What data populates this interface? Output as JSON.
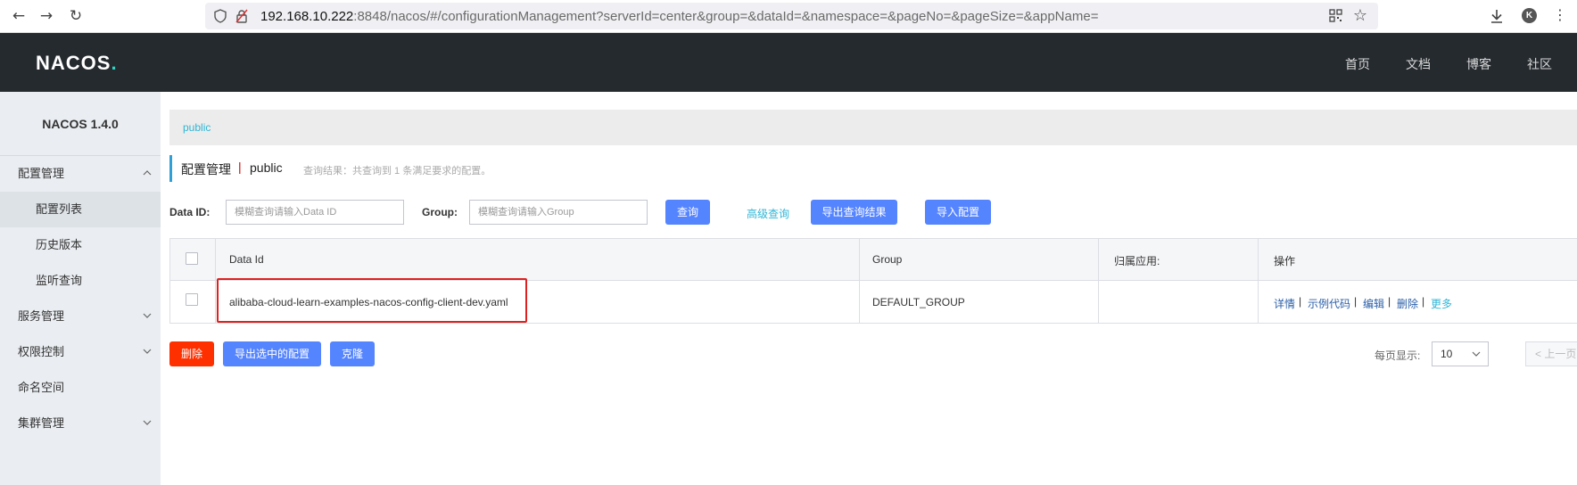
{
  "browser": {
    "url_host": "192.168.10.222",
    "url_rest": ":8848/nacos/#/configurationManagement?serverId=center&group=&dataId=&namespace=&pageNo=&pageSize=&appName=",
    "avatar_letter": "K",
    "icons": [
      "back-icon",
      "forward-icon",
      "reload-icon",
      "shield-icon",
      "insecure-lock-icon",
      "qr-code-icon",
      "star-icon",
      "download-icon",
      "menu-icon"
    ]
  },
  "header": {
    "logo_main": "NACOS",
    "logo_dot": ".",
    "nav": [
      "首页",
      "文档",
      "博客",
      "社区"
    ]
  },
  "sidebar": {
    "version": "NACOS 1.4.0",
    "items": [
      {
        "label": "配置管理",
        "expanded": true
      },
      {
        "label": "配置列表",
        "sub": true,
        "active": true
      },
      {
        "label": "历史版本",
        "sub": true
      },
      {
        "label": "监听查询",
        "sub": true
      },
      {
        "label": "服务管理"
      },
      {
        "label": "权限控制"
      },
      {
        "label": "命名空间"
      },
      {
        "label": "集群管理"
      }
    ]
  },
  "main": {
    "namespace_tab": "public",
    "title": "配置管理",
    "separator": "|",
    "namespace": "public",
    "result_hint": "查询结果：共查询到 1 条满足要求的配置。",
    "search": {
      "data_id_label": "Data ID:",
      "data_id_placeholder": "模糊查询请输入Data ID",
      "group_label": "Group:",
      "group_placeholder": "模糊查询请输入Group",
      "query_button": "查询",
      "advanced_link": "高级查询",
      "export_results_button": "导出查询结果",
      "import_button": "导入配置"
    },
    "table": {
      "headers": [
        "Data Id",
        "Group",
        "归属应用:",
        "操作"
      ],
      "rows": [
        {
          "data_id": "alibaba-cloud-learn-examples-nacos-config-client-dev.yaml",
          "group": "DEFAULT_GROUP",
          "app": "",
          "ops": [
            "详情",
            "示例代码",
            "编辑",
            "删除",
            "更多"
          ]
        }
      ]
    },
    "bulk": {
      "delete_button": "删除",
      "export_selected_button": "导出选中的配置",
      "clone_button": "克隆"
    },
    "pagination": {
      "page_size_label": "每页显示:",
      "page_size": "10",
      "prev_label": "< 上一页"
    }
  },
  "colors": {
    "header_bg": "#252a2f",
    "primary": "#5584ff",
    "danger": "#ff3000",
    "link": "#2fb6d6",
    "highlight_box": "#e02020"
  }
}
